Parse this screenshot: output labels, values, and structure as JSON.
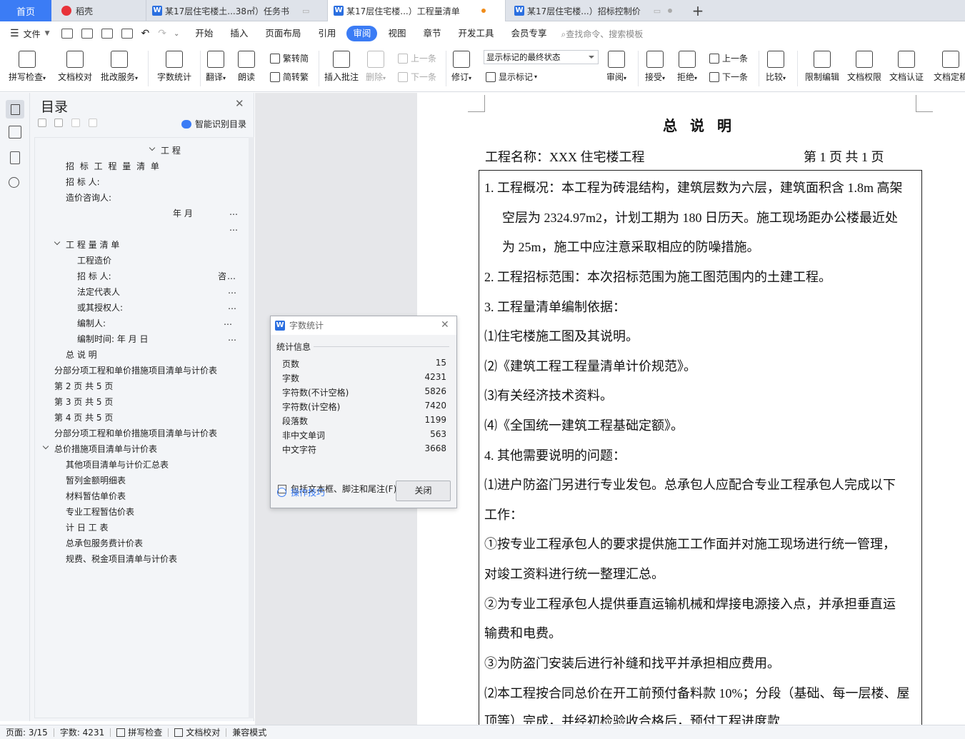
{
  "tabs": {
    "home": "首页",
    "docer": "稻壳",
    "doc1": "某17层住宅楼土...38㎡）任务书",
    "doc2": "某17层住宅楼...）工程量清单",
    "doc3": "某17层住宅楼...）招标控制价",
    "plus": "+"
  },
  "menu": {
    "file": "文件",
    "items": [
      "开始",
      "插入",
      "页面布局",
      "引用",
      "审阅",
      "视图",
      "章节",
      "开发工具",
      "会员专享"
    ],
    "active": "审阅",
    "search": "查找命令、搜索模板"
  },
  "ribbon": {
    "spell": "拼写检查",
    "proof": "文档校对",
    "batch": "批改服务",
    "wordcount": "字数统计",
    "translate": "翻译",
    "read": "朗读",
    "trad2simp": "繁转简",
    "simp2trad": "简转繁",
    "insert_comment": "插入批注",
    "delete": "删除",
    "prev_comment": "上一条",
    "next_comment": "下一条",
    "revise": "修订",
    "markup_select": "显示标记的最终状态",
    "show_markup": "显示标记",
    "review": "审阅",
    "accept": "接受",
    "reject": "拒绝",
    "prev": "上一条",
    "next": "下一条",
    "compare": "比较",
    "restrict": "限制编辑",
    "permission": "文档权限",
    "certify": "文档认证",
    "finalize": "文档定稿"
  },
  "toc": {
    "title": "目录",
    "smart": "智能识别目录",
    "items": [
      {
        "text": "工   程"
      },
      {
        "text": "招 标 工 程 量 清 单"
      },
      {
        "text": "招   标   人:"
      },
      {
        "text": "造价咨询人:"
      },
      {
        "text": "年         月"
      },
      {
        "text": "…"
      },
      {
        "text": "…"
      },
      {
        "text": "工   程   量   清   单"
      },
      {
        "text": "工程造价"
      },
      {
        "text": "招   标   人:"
      },
      {
        "text": "咨…"
      },
      {
        "text": "法定代表人"
      },
      {
        "text": "…"
      },
      {
        "text": "或其授权人:"
      },
      {
        "text": "…"
      },
      {
        "text": "编制人:"
      },
      {
        "text": "…"
      },
      {
        "text": "编制时间:         年      月      日"
      },
      {
        "text": "…"
      },
      {
        "text": "总   说   明"
      },
      {
        "text": "分部分项工程和单价措施项目清单与计价表"
      },
      {
        "text": "第 2 页  共 5 页"
      },
      {
        "text": "第 3 页  共 5 页"
      },
      {
        "text": "第 4 页  共 5 页"
      },
      {
        "text": "分部分项工程和单价措施项目清单与计价表"
      },
      {
        "text": "总价措施项目清单与计价表"
      },
      {
        "text": "其他项目清单与计价汇总表"
      },
      {
        "text": "暂列金额明细表"
      },
      {
        "text": "材料暂估单价表"
      },
      {
        "text": "专业工程暂估价表"
      },
      {
        "text": "计      日      工      表"
      },
      {
        "text": "总承包服务费计价表"
      },
      {
        "text": "规费、税金项目清单与计价表"
      }
    ]
  },
  "document": {
    "title": "总说明",
    "project_name": "工程名称：XXX 住宅楼工程",
    "page_info": "第 1 页  共 1 页",
    "lines": [
      "1.  工程概况：本工程为砖混结构，建筑层数为六层，建筑面积含 1.8m 高架",
      "空层为 2324.97m2，计划工期为 180 日历天。施工现场距办公楼最近处",
      "为 25m，施工中应注意采取相应的防噪措施。",
      "2.  工程招标范围：本次招标范围为施工图范围内的土建工程。",
      "3.  工程量清单编制依据：",
      "⑴住宅楼施工图及其说明。",
      "⑵《建筑工程工程量清单计价规范》。",
      "⑶有关经济技术资料。",
      "⑷《全国统一建筑工程基础定额》。",
      "4.  其他需要说明的问题：",
      "⑴进户防盗门另进行专业发包。总承包人应配合专业工程承包人完成以下",
      "工作：",
      "①按专业工程承包人的要求提供施工工作面并对施工现场进行统一管理，",
      "对竣工资料进行统一整理汇总。",
      "②为专业工程承包人提供垂直运输机械和焊接电源接入点，并承担垂直运",
      "输费和电费。",
      "③为防盗门安装后进行补缝和找平并承担相应费用。",
      "⑵本工程按合同总价在开工前预付备料款 10%；分段（基础、每一层楼、屋",
      "顶等）完成，并经初检验收合格后，预付工程进度款"
    ]
  },
  "dialog": {
    "title": "字数统计",
    "group": "统计信息",
    "stats": [
      {
        "label": "页数",
        "value": "15"
      },
      {
        "label": "字数",
        "value": "4231"
      },
      {
        "label": "字符数(不计空格)",
        "value": "5826"
      },
      {
        "label": "字符数(计空格)",
        "value": "7420"
      },
      {
        "label": "段落数",
        "value": "1199"
      },
      {
        "label": "非中文单词",
        "value": "563"
      },
      {
        "label": "中文字符",
        "value": "3668"
      }
    ],
    "checkbox": "包括文本框、脚注和尾注(F)",
    "tips": "操作技巧",
    "close": "关闭"
  },
  "status": {
    "page": "页面: 3/15",
    "words": "字数: 4231",
    "spell": "拼写检查",
    "proof": "文档校对",
    "compat": "兼容模式"
  },
  "colors": {
    "accent": "#3b7cf5",
    "tab_active": "#3b7cf5"
  }
}
